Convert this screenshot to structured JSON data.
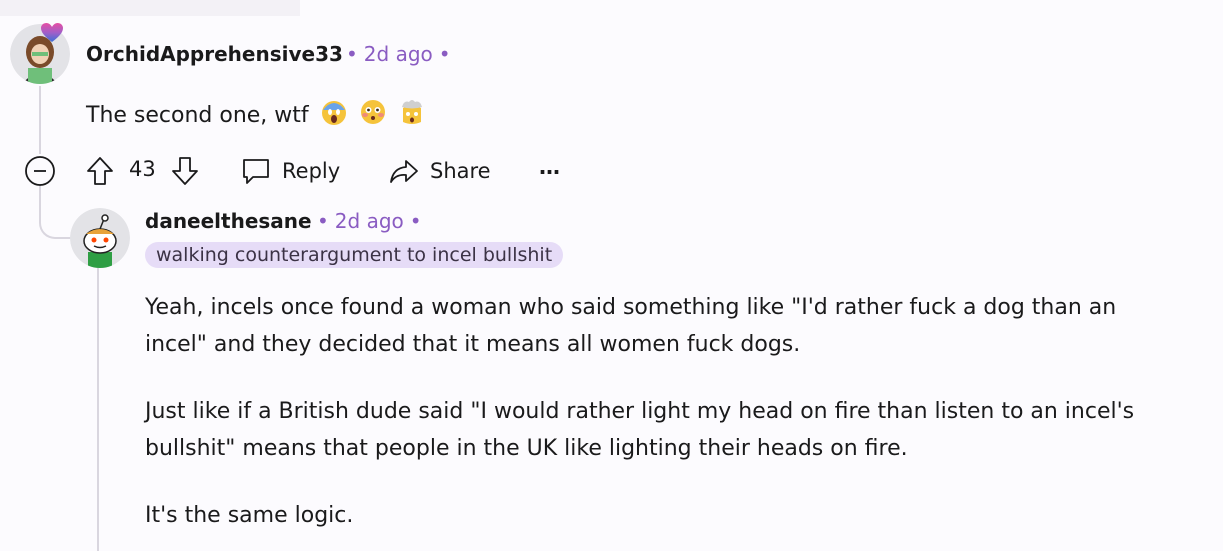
{
  "comment1": {
    "username": "OrchidApprehensive33",
    "time": "2d ago",
    "text": "The second one, wtf",
    "emojis": [
      "fearful-scream-emoji",
      "flushed-face-emoji",
      "exploding-head-emoji"
    ],
    "actions": {
      "collapse_icon": "minus-circle-icon",
      "votes": "43",
      "reply": "Reply",
      "share": "Share",
      "more": "…"
    }
  },
  "comment2": {
    "username": "daneelthesane",
    "time": "2d ago",
    "flair": "walking counterargument to incel bullshit",
    "paragraphs": [
      "Yeah, incels once found a woman who said something like \"I'd rather fuck a dog than an incel\" and they decided that it means all women fuck dogs.",
      "Just like if a British dude said \"I would rather light my head on fire than listen to an incel's bullshit\" means that people in the UK like lighting their heads on fire.",
      "It's the same logic."
    ]
  },
  "colors": {
    "accent_meta": "#8a5cc2",
    "flair_bg": "#e6dcf7",
    "thread_line": "#d9d6df",
    "background": "#fcfbfe"
  }
}
